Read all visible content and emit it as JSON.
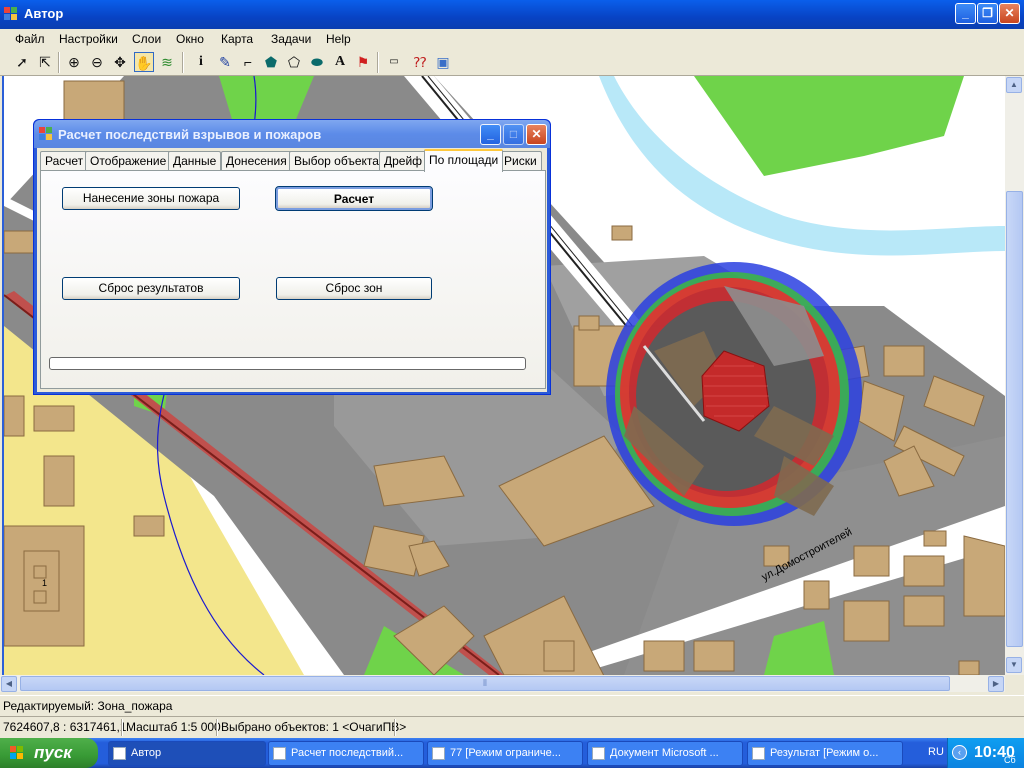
{
  "window": {
    "title": "Автор"
  },
  "menu": [
    "Файл",
    "Настройки",
    "Слои",
    "Окно",
    "Карта",
    "Задачи",
    "Help"
  ],
  "map": {
    "street_label": "ул.Домостроителей",
    "building_label": "1"
  },
  "dialog": {
    "title": "Расчет последствий взрывов и пожаров",
    "tabs": [
      "Расчет",
      "Отображение",
      "Данные",
      "Донесения",
      "Выбор объекта",
      "Дрейф",
      "По площади",
      "Риски"
    ],
    "selected_tab": "По площади",
    "buttons": {
      "fire_zone": "Нанесение зоны пожара",
      "calculate": "Расчет",
      "reset_results": "Сброс результатов",
      "reset_zones": "Сброс зон"
    }
  },
  "editbar": {
    "text": "Редактируемый: Зона_пожара"
  },
  "status": {
    "coords": "7624607,8 : 6317461,1",
    "scale": "Масштаб 1:5 000",
    "selected": "Выбрано объектов: 1 <ОчагиПВ>"
  },
  "taskbar": {
    "start": "пуск",
    "tasks": [
      "Автор",
      "Расчет последствий...",
      "77 [Режим ограниче...",
      "Документ Microsoft ...",
      "Результат [Режим о..."
    ],
    "lang": "RU",
    "time": "10:40",
    "day": "Сб"
  },
  "colors": {
    "titlebar": "#0A5FEB",
    "taskbar": "#245EDB",
    "start": "#389A35",
    "zone_red": "#E53030",
    "zone_green": "#3CB44A",
    "zone_blue": "#2A3FE0"
  }
}
